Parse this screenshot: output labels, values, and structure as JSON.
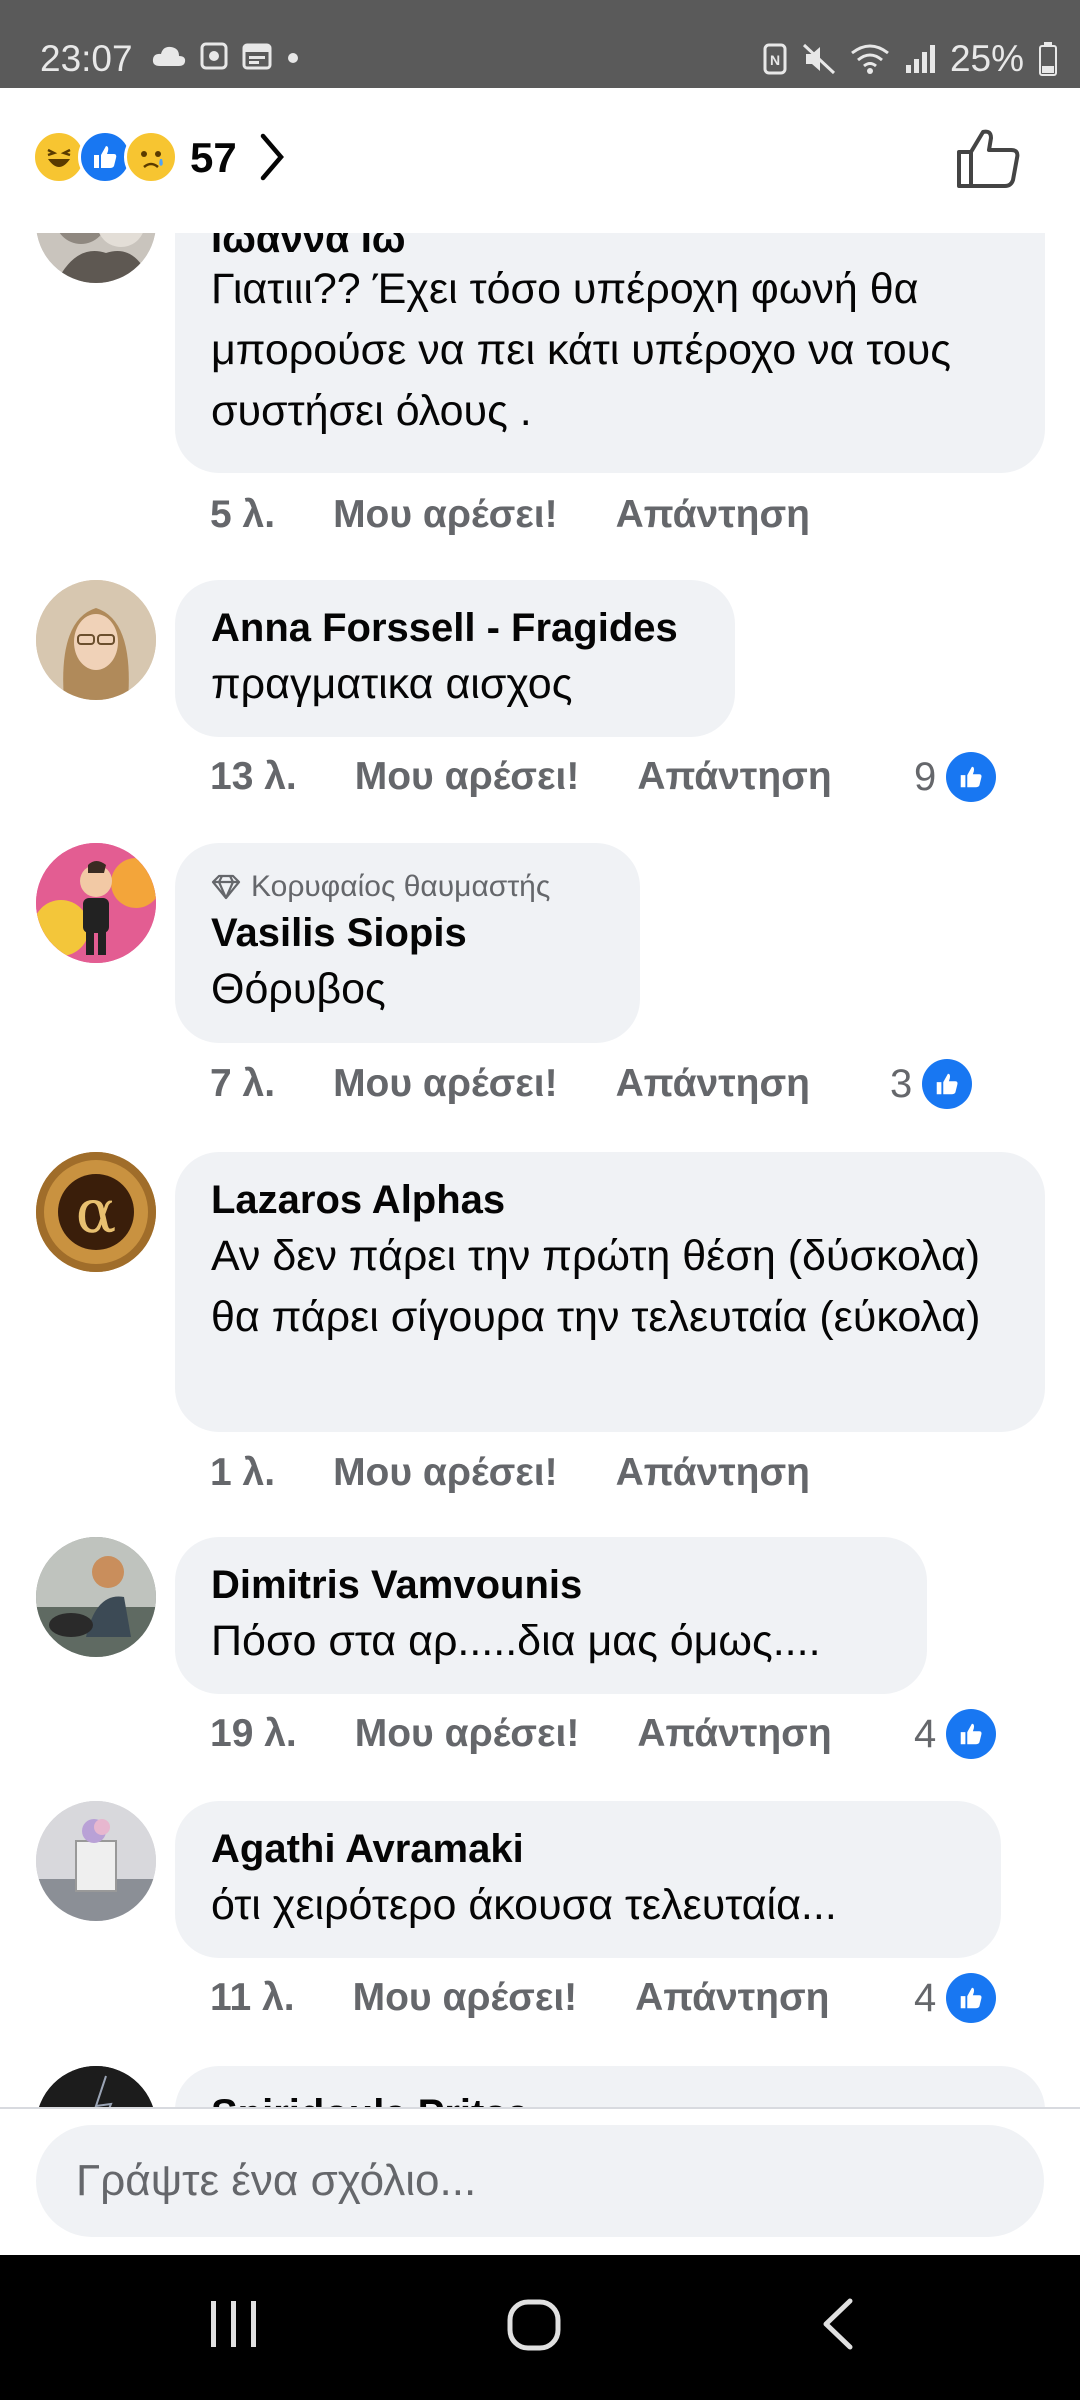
{
  "status_bar": {
    "time": "23:07",
    "battery": "25%",
    "left_icons": [
      "cloud-icon",
      "app-icon",
      "calendar-icon",
      "dot-icon"
    ],
    "right_icons": [
      "nfc-icon",
      "mute-icon",
      "wifi-icon",
      "signal-icon",
      "battery-icon"
    ]
  },
  "reactions": {
    "count": "57",
    "emojis": [
      "haha-emoji-icon",
      "like-emoji-icon",
      "sad-emoji-icon"
    ]
  },
  "comments": [
    {
      "name": "Ιωάννα Ιω",
      "text": "Γιατιιι?? Έχει τόσο υπέροχη φωνή θα μπορούσε να πει κάτι υπέροχο να τους συστήσει  όλους .",
      "time": "5 λ.",
      "like_label": "Μου αρέσει!",
      "reply_label": "Απάντηση"
    },
    {
      "name": "Anna Forssell - Fragides",
      "text": "πραγματικα αισχος",
      "time": "13 λ.",
      "like_label": "Μου αρέσει!",
      "reply_label": "Απάντηση",
      "likes": "9"
    },
    {
      "badge": "Κορυφαίος θαυμαστής",
      "name": "Vasilis Siopis",
      "text": "Θόρυβος",
      "time": "7 λ.",
      "like_label": "Μου αρέσει!",
      "reply_label": "Απάντηση",
      "likes": "3"
    },
    {
      "name": "Lazaros Alphas",
      "text": "Αν δεν πάρει την πρώτη θέση (δύσκολα) θα πάρει σίγουρα την τελευταία (εύκολα)",
      "time": "1 λ.",
      "like_label": "Μου αρέσει!",
      "reply_label": "Απάντηση"
    },
    {
      "name": "Dimitris Vamvounis",
      "text": "Πόσο στα αρ.....δια μας όμως....",
      "time": "19 λ.",
      "like_label": "Μου αρέσει!",
      "reply_label": "Απάντηση",
      "likes": "4"
    },
    {
      "name": "Agathi Avramaki",
      "text": "ότι χειρότερο άκουσα τελευταία...",
      "time": "11 λ.",
      "like_label": "Μου αρέσει!",
      "reply_label": "Απάντηση",
      "likes": "4"
    },
    {
      "name": "Spiridoula Pritsa"
    }
  ],
  "input": {
    "placeholder": "Γράψτε ένα σχόλιο..."
  },
  "nav": {
    "buttons": [
      "recents-icon",
      "home-icon",
      "back-icon"
    ]
  },
  "colors": {
    "accent": "#1877f2",
    "bubble": "#f0f2f5",
    "secondary_text": "#65676b"
  }
}
